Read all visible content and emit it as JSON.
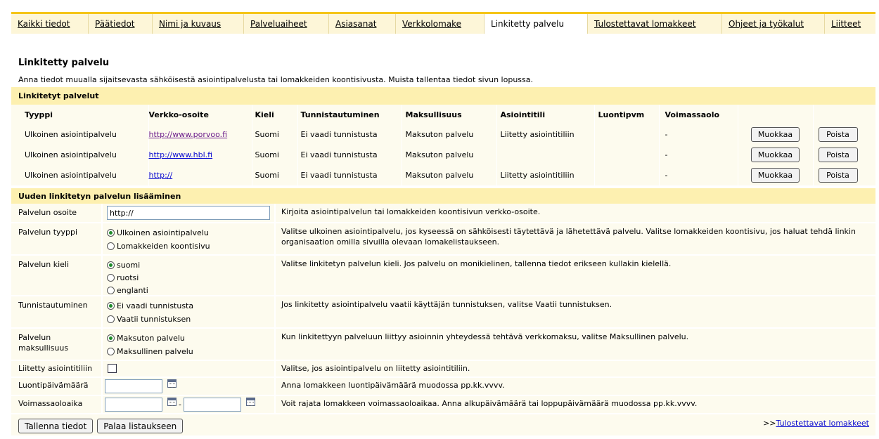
{
  "tabs": [
    {
      "label": "Kaikki tiedot"
    },
    {
      "label": "Päätiedot"
    },
    {
      "label": "Nimi ja kuvaus"
    },
    {
      "label": "Palveluaiheet"
    },
    {
      "label": "Asiasanat"
    },
    {
      "label": "Verkkolomake"
    },
    {
      "label": "Linkitetty palvelu"
    },
    {
      "label": "Tulostettavat lomakkeet"
    },
    {
      "label": "Ohjeet ja työkalut"
    },
    {
      "label": "Liitteet"
    }
  ],
  "page": {
    "title": "Linkitetty palvelu",
    "intro": "Anna tiedot muualla sijaitsevasta sähköisestä asiointipalvelusta tai lomakkeiden koontisivusta. Muista tallentaa tiedot sivun lopussa."
  },
  "linked": {
    "section_title": "Linkitetyt palvelut",
    "columns": [
      "Tyyppi",
      "Verkko-osoite",
      "Kieli",
      "Tunnistautuminen",
      "Maksullisuus",
      "Asiointitili",
      "Luontipvm",
      "Voimassaolo"
    ],
    "rows": [
      {
        "type": "Ulkoinen asiointipalvelu",
        "url": "http://www.porvoo.fi",
        "lang": "Suomi",
        "auth": "Ei vaadi tunnistusta",
        "fee": "Maksuton palvelu",
        "account": "Liitetty asiointitiliin",
        "created": "",
        "validity": "-"
      },
      {
        "type": "Ulkoinen asiointipalvelu",
        "url": "http://www.hbl.fi",
        "lang": "Suomi",
        "auth": "Ei vaadi tunnistusta",
        "fee": "Maksuton palvelu",
        "account": "",
        "created": "",
        "validity": "-"
      },
      {
        "type": "Ulkoinen asiointipalvelu",
        "url": "http://",
        "lang": "Suomi",
        "auth": "Ei vaadi tunnistusta",
        "fee": "Maksuton palvelu",
        "account": "Liitetty asiointitiliin",
        "created": "",
        "validity": "-"
      }
    ],
    "edit_label": "Muokkaa",
    "delete_label": "Poista"
  },
  "form": {
    "section_title": "Uuden linkitetyn palvelun lisääminen",
    "address": {
      "label": "Palvelun osoite",
      "value": "http://",
      "help": "Kirjoita asiointipalvelun tai lomakkeiden koontisivun verkko-osoite."
    },
    "type": {
      "label": "Palvelun tyyppi",
      "options": [
        "Ulkoinen asiointipalvelu",
        "Lomakkeiden koontisivu"
      ],
      "selected": 0,
      "help": "Valitse ulkoinen asiointipalvelu, jos kyseessä on sähköisesti täytettävä ja lähetettävä palvelu. Valitse lomakkeiden koontisivu, jos haluat tehdä linkin organisaation omilla sivuilla olevaan lomakelistaukseen."
    },
    "language": {
      "label": "Palvelun kieli",
      "options": [
        "suomi",
        "ruotsi",
        "englanti"
      ],
      "selected": 0,
      "help": "Valitse linkitetyn palvelun kieli. Jos palvelu on monikielinen, tallenna tiedot erikseen kullakin kielellä."
    },
    "auth": {
      "label": "Tunnistautuminen",
      "options": [
        "Ei vaadi tunnistusta",
        "Vaatii tunnistuksen"
      ],
      "selected": 0,
      "help": "Jos linkitetty asiointipalvelu vaatii käyttäjän tunnistuksen, valitse Vaatii tunnistuksen."
    },
    "fee": {
      "label": "Palvelun maksullisuus",
      "options": [
        "Maksuton palvelu",
        "Maksullinen palvelu"
      ],
      "selected": 0,
      "help": "Kun linkitettyyn palveluun liittyy asioinnin yhteydessä tehtävä verkkomaksu, valitse Maksullinen palvelu."
    },
    "account": {
      "label": "Liitetty asiointitiliin",
      "help": "Valitse, jos asiointipalvelu on liitetty asiointitiliin."
    },
    "created": {
      "label": "Luontipäivämäärä",
      "help": "Anna lomakkeen luontipäivämäärä muodossa pp.kk.vvvv."
    },
    "validity": {
      "label": "Voimassaoloaika",
      "separator": "-",
      "help": "Voit rajata lomakkeen voimassaoloaikaa. Anna alkupäivämäärä tai loppupäivämäärä muodossa pp.kk.vvvv."
    }
  },
  "footer": {
    "save_label": "Tallenna tiedot",
    "back_label": "Palaa listaukseen",
    "link_prefix": ">>",
    "link_label": "Tulostettavat lomakkeet"
  }
}
